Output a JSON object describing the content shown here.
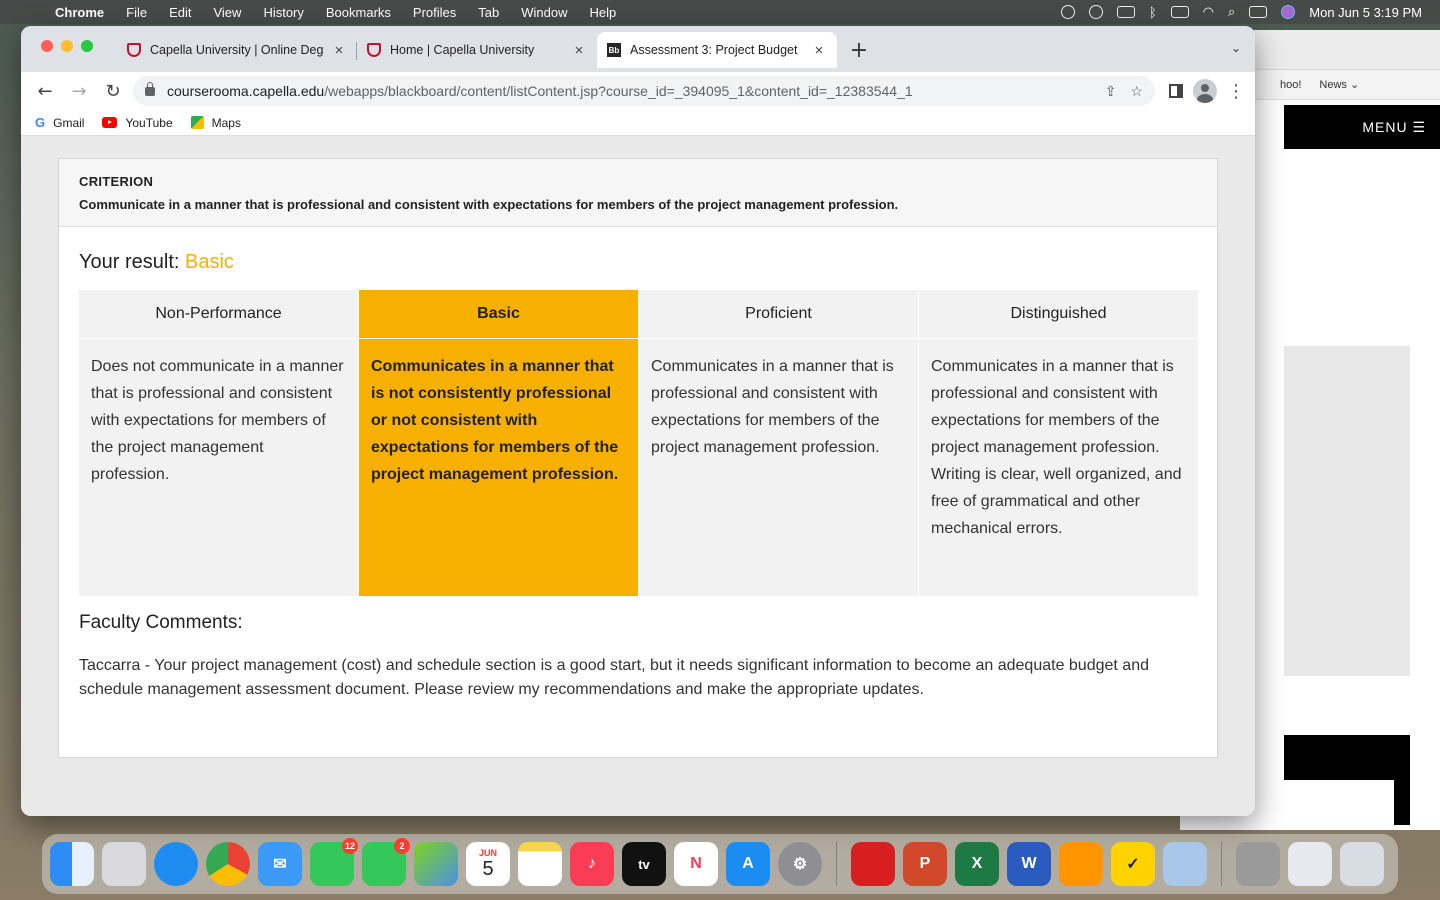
{
  "menubar": {
    "app": "Chrome",
    "items": [
      "File",
      "Edit",
      "View",
      "History",
      "Bookmarks",
      "Profiles",
      "Tab",
      "Window",
      "Help"
    ],
    "clock": "Mon Jun 5  3:19 PM"
  },
  "bg_window": {
    "favorites": [
      "hoo!",
      "News ⌄"
    ],
    "menu_label": "MENU ☰"
  },
  "tabs": [
    {
      "label": "Capella University | Online Deg",
      "icon": "capella-shield-icon"
    },
    {
      "label": "Home | Capella University",
      "icon": "capella-shield-icon"
    },
    {
      "label": "Assessment 3: Project Budget",
      "icon": "blackboard-icon",
      "active": true
    }
  ],
  "omnibox": {
    "host": "courserooma.capella.edu",
    "path": "/webapps/blackboard/content/listContent.jsp?course_id=_394095_1&content_id=_12383544_1"
  },
  "bookmarks": [
    "Gmail",
    "YouTube",
    "Maps"
  ],
  "criterion": {
    "heading": "CRITERION",
    "text": "Communicate in a manner that is professional and consistent with expectations for members of the project management profession."
  },
  "result": {
    "label": "Your result:",
    "level": "Basic",
    "level_color": "#f7b000"
  },
  "rubric": {
    "columns": [
      {
        "header": "Non-Performance",
        "text": "Does not communicate in a manner that is professional and consistent with expectations for members of the project management profession."
      },
      {
        "header": "Basic",
        "selected": true,
        "text": "Communicates in a manner that is not consistently professional or not consistent with expectations for members of the project management profession."
      },
      {
        "header": "Proficient",
        "text": "Communicates in a manner that is professional and consistent with expectations for members of the project management profession."
      },
      {
        "header": "Distinguished",
        "text": "Communicates in a manner that is professional and consistent with expectations for members of the project management profession. Writing is clear, well organized, and free of grammatical and other mechanical errors."
      }
    ]
  },
  "faculty": {
    "title": "Faculty Comments:",
    "comment": "Taccarra - Your project management (cost) and schedule section is a good start, but it needs significant information to become an adequate budget and schedule management assessment document. Please review my recommendations and make the appropriate updates."
  },
  "dock": {
    "badges": {
      "facetime": "12",
      "messages": "2"
    },
    "calendar_month": "JUN",
    "calendar_day": "5",
    "appletv_label": "tv"
  }
}
